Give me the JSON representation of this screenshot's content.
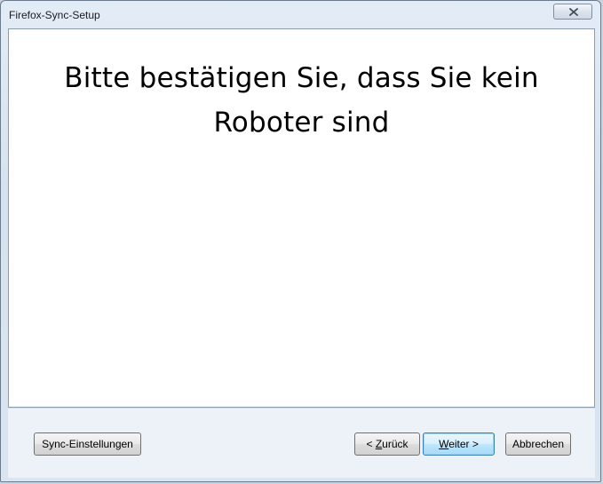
{
  "window": {
    "title": "Firefox-Sync-Setup"
  },
  "main": {
    "heading": "Bitte bestätigen Sie, dass Sie kein Roboter sind"
  },
  "footer": {
    "sync_settings_label": "Sync-Einstellungen",
    "back_label_prefix": "< ",
    "back_label_accel": "Z",
    "back_label_rest": "urück",
    "next_label_accel": "W",
    "next_label_rest": "eiter >",
    "cancel_label": "Abbrechen"
  },
  "icons": {
    "close": "close-icon"
  },
  "colors": {
    "default_button_border": "#3c7fb1",
    "window_frame": "#dbe5f0"
  }
}
